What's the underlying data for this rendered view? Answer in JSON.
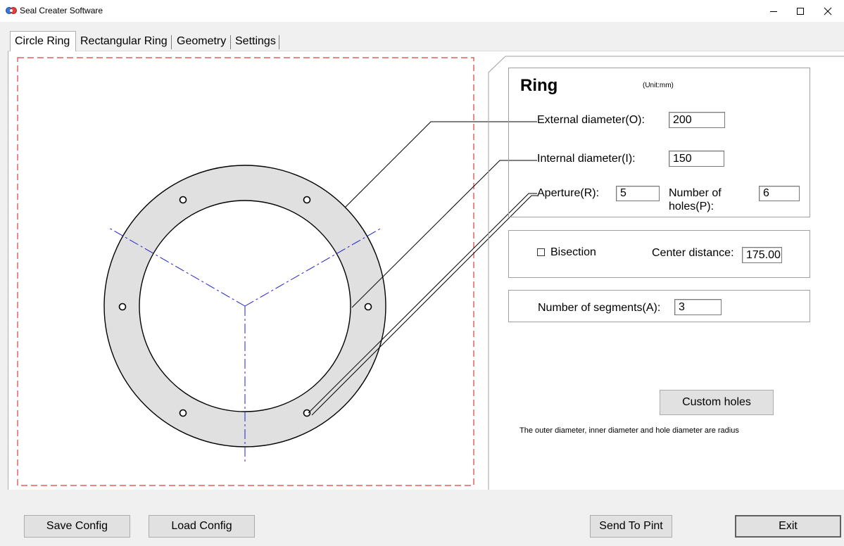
{
  "window": {
    "title": "Seal Creater Software",
    "controls": [
      "minimize",
      "maximize",
      "close"
    ]
  },
  "tabs": [
    {
      "label": "Circle Ring",
      "selected": true
    },
    {
      "label": "Rectangular Ring",
      "selected": false
    },
    {
      "label": "Geometry",
      "selected": false
    },
    {
      "label": "Settings",
      "selected": false
    }
  ],
  "ring_panel": {
    "title": "Ring",
    "unit": "(Unit:mm)",
    "external_diameter_label": "External diameter(O):",
    "external_diameter_value": "200",
    "internal_diameter_label": "Internal diameter(I):",
    "internal_diameter_value": "150",
    "aperture_label": "Aperture(R):",
    "aperture_value": "5",
    "holes_label_line1": "Number of",
    "holes_label_line2": "holes(P):",
    "holes_value": "6"
  },
  "bisection": {
    "label": "Bisection",
    "checked": false,
    "center_distance_label": "Center distance:",
    "center_distance_value": "175.00"
  },
  "segments": {
    "label": "Number of segments(A):",
    "value": "3"
  },
  "custom_holes_button": "Custom holes",
  "note": "The outer diameter, inner diameter and hole diameter are radius",
  "footer": {
    "save_config": "Save Config",
    "load_config": "Load Config",
    "send_to_print": "Send To Pint",
    "exit": "Exit"
  },
  "drawing": {
    "segments": 3,
    "holes": 6,
    "colors": {
      "ring_fill": "#e0e0e0",
      "frame_dash": "#e03c3c",
      "segment_line": "#2020d0"
    }
  }
}
